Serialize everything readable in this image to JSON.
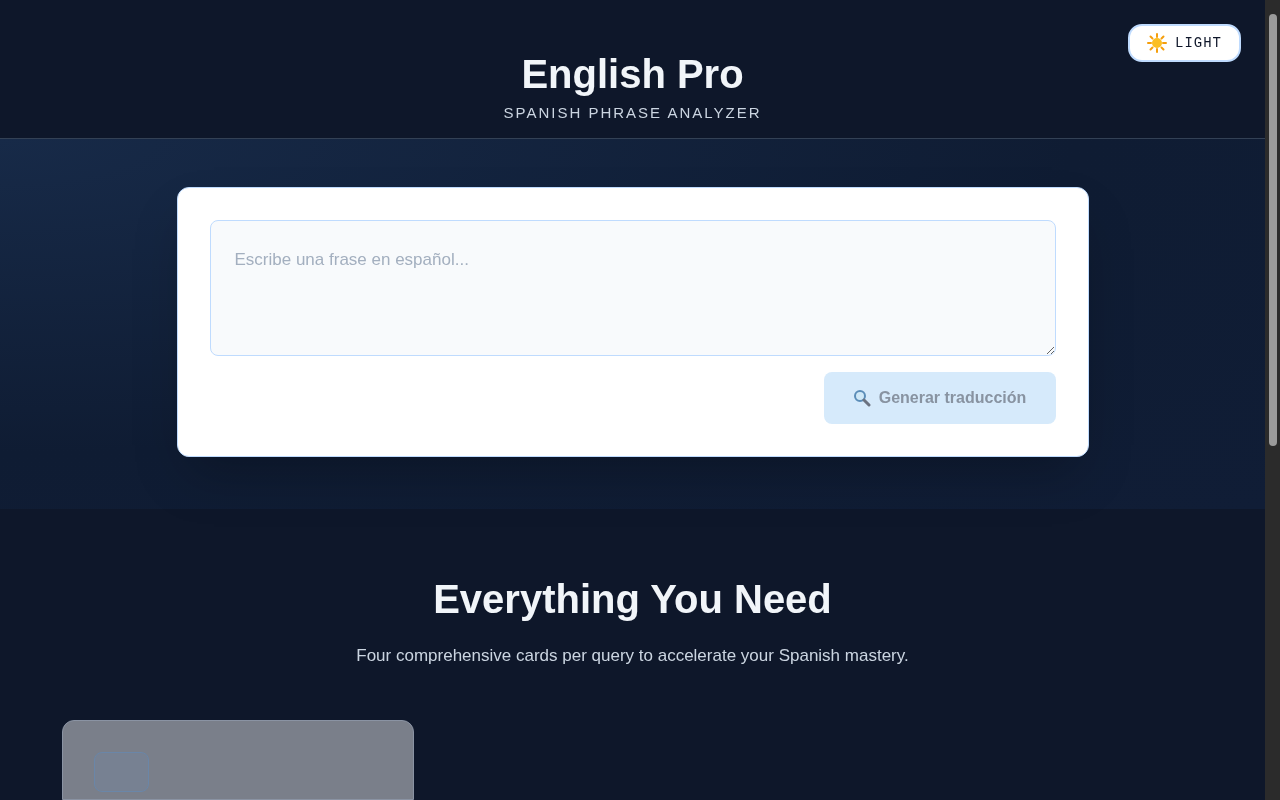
{
  "header": {
    "title": "English Pro",
    "subtitle": "SPANISH PHRASE ANALYZER",
    "theme_button": {
      "label": "LIGHT"
    }
  },
  "translator": {
    "input": {
      "placeholder": "Escribe una frase en español..."
    },
    "submit": {
      "label": "Generar traducción",
      "disabled": true
    }
  },
  "features": {
    "heading": "Everything You Need",
    "description": "Four comprehensive cards per query to accelerate your Spanish mastery."
  }
}
